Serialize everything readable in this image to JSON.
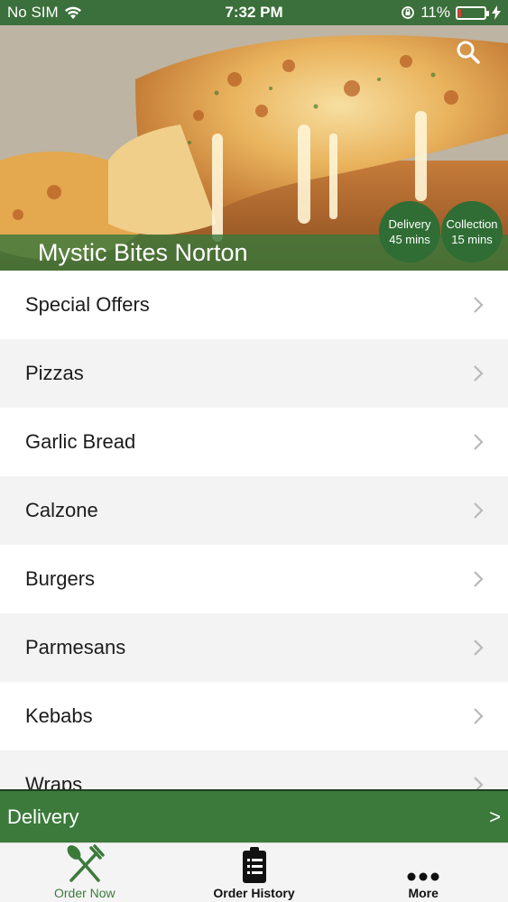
{
  "status_bar": {
    "carrier": "No SIM",
    "time": "7:32 PM",
    "battery": "11%",
    "battery_level": 0.11
  },
  "hero": {
    "store_name": "Mystic Bites Norton",
    "search_icon": "search-icon",
    "delivery_badge": {
      "label": "Delivery",
      "time": "45 mins"
    },
    "collection_badge": {
      "label": "Collection",
      "time": "15 mins"
    }
  },
  "menu": {
    "items": [
      {
        "label": "Special Offers"
      },
      {
        "label": "Pizzas"
      },
      {
        "label": "Garlic Bread"
      },
      {
        "label": "Calzone"
      },
      {
        "label": "Burgers"
      },
      {
        "label": "Parmesans"
      },
      {
        "label": "Kebabs"
      },
      {
        "label": "Wraps"
      }
    ]
  },
  "delivery_bar": {
    "label": "Delivery",
    "arrow": ">"
  },
  "tab_bar": {
    "tabs": [
      {
        "label": "Order Now",
        "icon": "fork-knife-icon",
        "active": true
      },
      {
        "label": "Order History",
        "icon": "clipboard-icon",
        "active": false
      },
      {
        "label": "More",
        "icon": "more-dots-icon",
        "active": false
      }
    ]
  },
  "colors": {
    "brand_green": "#3b7a3b",
    "badge_green": "#2f6d34",
    "battery_low": "#e53935"
  }
}
